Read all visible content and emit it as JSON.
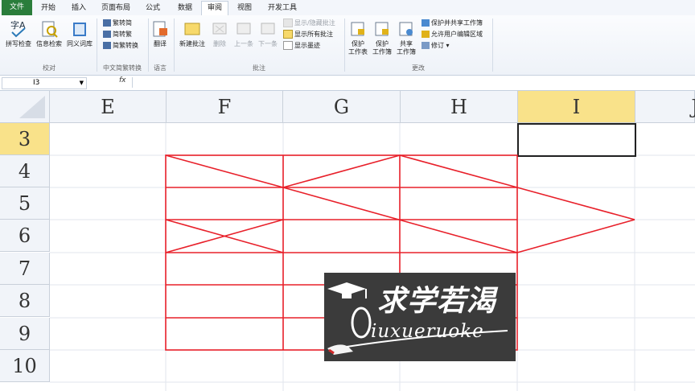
{
  "tabs": [
    "文件",
    "开始",
    "插入",
    "页面布局",
    "公式",
    "数据",
    "审阅",
    "视图",
    "开发工具"
  ],
  "active_tab": "审阅",
  "ribbon": {
    "groups": {
      "proofing": {
        "label": "校对",
        "buttons": [
          "拼写检查",
          "信息检索",
          "同义词库"
        ]
      },
      "chinese": {
        "label": "中文简繁转换",
        "buttons": [
          "繁转简",
          "简转繁",
          "简繁转换"
        ]
      },
      "language": {
        "label": "语言",
        "buttons": [
          "翻译"
        ]
      },
      "comments": {
        "label": "批注",
        "buttons": [
          "新建批注",
          "删除",
          "上一条",
          "下一条"
        ],
        "small": [
          "显示/隐藏批注",
          "显示所有批注",
          "显示墨迹"
        ]
      },
      "changes": {
        "label": "更改",
        "buttons": [
          [
            "保护",
            "工作表"
          ],
          [
            "保护",
            "工作簿"
          ],
          [
            "共享",
            "工作簿"
          ]
        ],
        "small": [
          "保护并共享工作簿",
          "允许用户编辑区域",
          "修订"
        ]
      }
    }
  },
  "formula_bar": {
    "name_box": "I3",
    "fx": "fx",
    "value": ""
  },
  "columns": [
    "E",
    "F",
    "G",
    "H",
    "I",
    "J"
  ],
  "rows": [
    "3",
    "4",
    "5",
    "6",
    "7",
    "8",
    "9",
    "10"
  ],
  "selected_cell": {
    "column": "I",
    "row": "3"
  },
  "watermark": {
    "title": "求学若渴",
    "subtitle": "iuxueruoke"
  },
  "colors": {
    "accent_file": "#2a7d3b",
    "drawing_red": "#e8202a",
    "selected_header": "#f9e28a",
    "watermark_bg": "#3b3b3b"
  },
  "icons": [
    "spellcheck-icon",
    "research-icon",
    "thesaurus-icon",
    "translate-icon",
    "new-comment-icon",
    "delete-comment-icon",
    "previous-comment-icon",
    "next-comment-icon",
    "protect-sheet-icon",
    "protect-workbook-icon",
    "share-workbook-icon",
    "graduation-cap-icon"
  ]
}
